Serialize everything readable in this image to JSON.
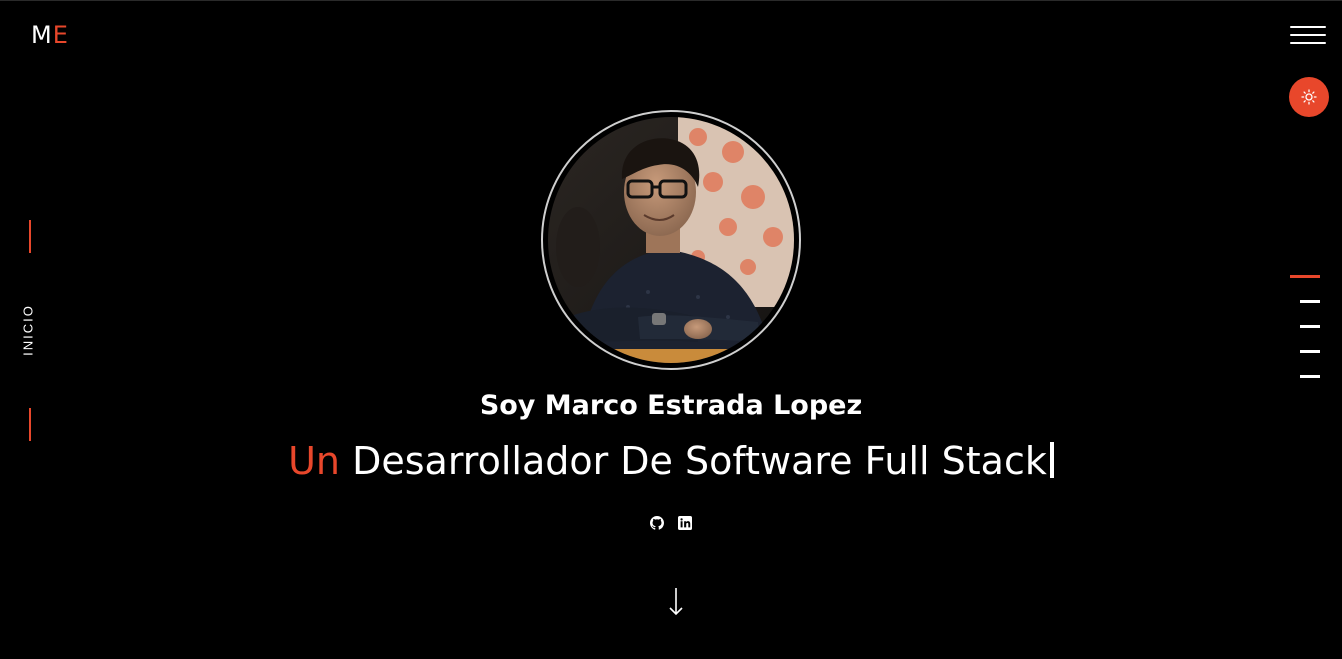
{
  "brand": {
    "logo_first": "M",
    "logo_second": "E"
  },
  "colors": {
    "accent": "#e8472b",
    "background": "#000000",
    "text": "#ffffff"
  },
  "header": {
    "menu_icon": "hamburger-menu-icon",
    "theme_toggle_icon": "sun-icon"
  },
  "sidebar": {
    "current_section": "INICIO"
  },
  "section_nav": {
    "count": 5,
    "active_index": 0
  },
  "hero": {
    "greeting": "Soy Marco Estrada Lopez",
    "role_prefix": "Un",
    "role_text": "Desarrollador De Software Full Stack",
    "avatar_alt": "Marco Estrada Lopez",
    "socials": [
      {
        "icon": "github-icon"
      },
      {
        "icon": "linkedin-icon"
      }
    ],
    "scroll_icon": "arrow-down-icon"
  }
}
